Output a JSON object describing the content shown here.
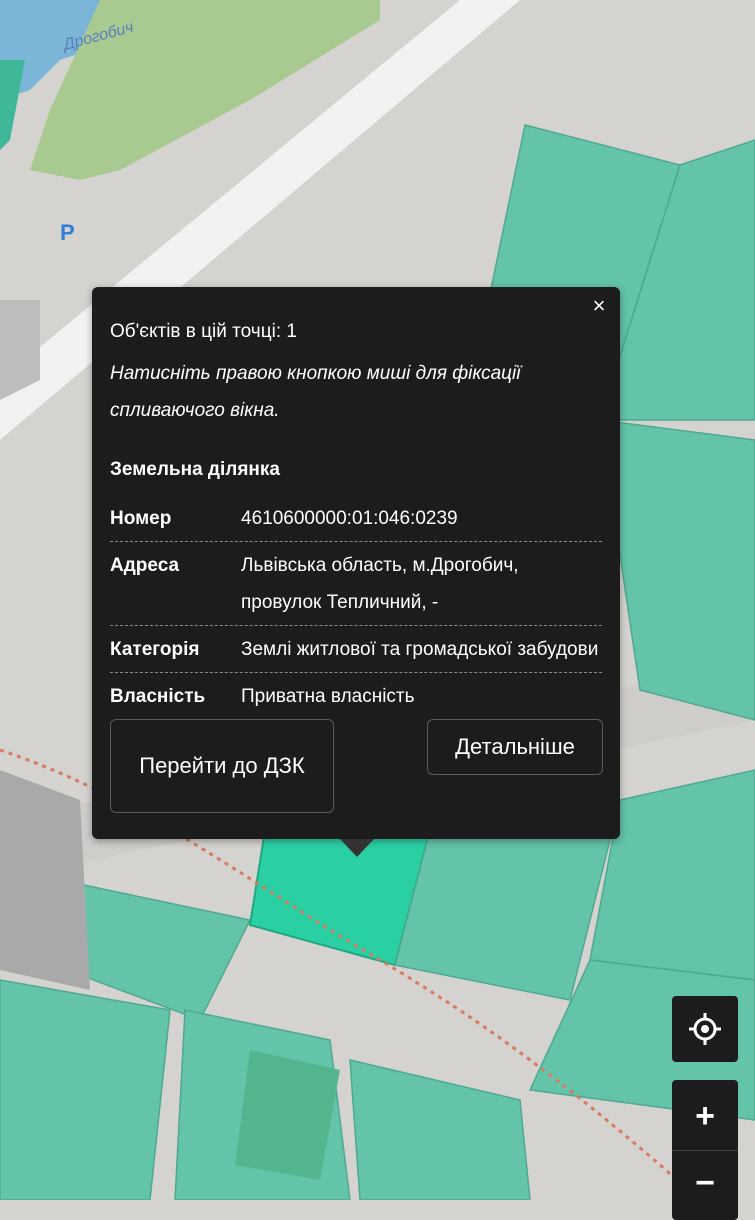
{
  "map": {
    "labels": [
      {
        "text": "Дрогобич",
        "color": "#5a7fc0"
      },
      {
        "text": "P",
        "color": "#2f7fd6"
      }
    ],
    "colors": {
      "background": "#d5d3d0",
      "parcel": "#63c4aa",
      "parcel_selected": "#2ad0a4",
      "park": "#a8c98f",
      "water": "#6cb0d8",
      "road": "#f2f2f2",
      "rail": "#d87a60"
    }
  },
  "popup": {
    "close_label": "×",
    "count_text": "Об'єктів в цій точці: 1",
    "hint_text": "Натисніть правою кнопкою миші для фіксації спливаючого вікна.",
    "section_title": "Земельна ділянка",
    "fields": [
      {
        "key": "Номер",
        "value": "4610600000:01:046:0239"
      },
      {
        "key": "Адреса",
        "value": "Львівська область, м.Дрогобич, провулок Тепличний, -"
      },
      {
        "key": "Категорія",
        "value": "Землі житлової та громадської забудови"
      },
      {
        "key": "Власність",
        "value": "Приватна власність"
      }
    ],
    "buttons": {
      "dzk_label": "Перейти до ДЗК",
      "details_label": "Детальніше"
    }
  },
  "controls": {
    "zoom_in_label": "+",
    "zoom_out_label": "−"
  }
}
